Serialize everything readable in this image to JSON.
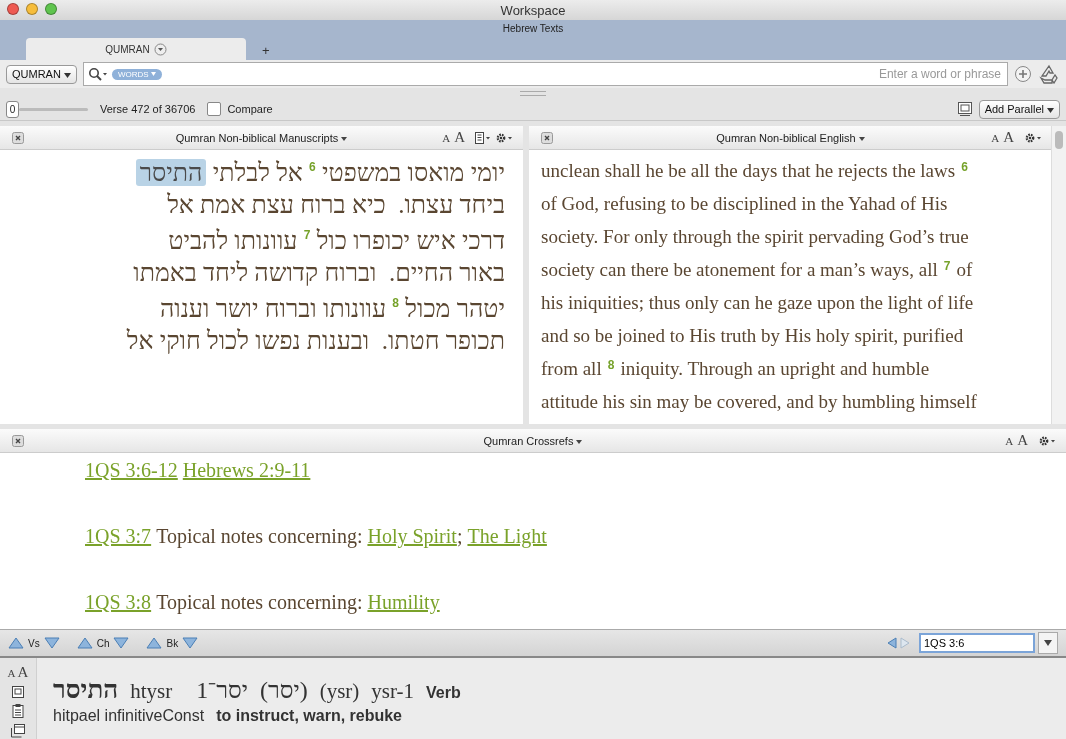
{
  "window": {
    "title": "Workspace",
    "subtitle": "Hebrew Texts"
  },
  "tabs": [
    {
      "label": "QUMRAN",
      "selected": true
    }
  ],
  "new_tab": "+",
  "search": {
    "module": "QUMRAN",
    "scope": "WORDS",
    "placeholder": "Enter a word or phrase"
  },
  "toolbar": {
    "slider_value": "0",
    "level": 0,
    "verse_info": "Verse 472 of 36706",
    "compare": {
      "label": "Compare",
      "checked": false
    },
    "add_parallel": "Add Parallel"
  },
  "panes": [
    {
      "title": "Qumran Non-biblical Manuscripts",
      "font_small": "A",
      "font_large": "A",
      "lines": [
        [
          {
            "kind": "text",
            "text": "יומי מואסו במשפטי "
          },
          {
            "kind": "verse",
            "text": "6"
          },
          {
            "kind": "text",
            "text": " אל לבלתי "
          },
          {
            "kind": "highlight",
            "text": "התיסר"
          }
        ],
        [
          {
            "kind": "text",
            "text": "ביחד עצתו.  כיא ברוח עצת אמת אל"
          }
        ],
        [
          {
            "kind": "text",
            "text": "דרכי איש יכופרו כול "
          },
          {
            "kind": "verse",
            "text": "7"
          },
          {
            "kind": "text",
            "text": " עוונותו להביט"
          }
        ],
        [
          {
            "kind": "text",
            "text": "באור החיים.  וברוח קדושה ליחד באמתו"
          }
        ],
        [
          {
            "kind": "text",
            "text": "יטהר מכול "
          },
          {
            "kind": "verse",
            "text": "8"
          },
          {
            "kind": "text",
            "text": " עוונותו וברוח יושר וענוה"
          }
        ],
        [
          {
            "kind": "text",
            "text": "תכופר חטתו.  ובענות נפשו לכול חוקי אל"
          }
        ]
      ]
    },
    {
      "title": "Qumran Non-biblical English",
      "font_small": "A",
      "font_large": "A",
      "lines": [
        [
          {
            "kind": "text",
            "text": "unclean shall he be all the days that he rejects the laws"
          },
          {
            "kind": "verse",
            "text": "6"
          }
        ],
        [
          {
            "kind": "text",
            "text": "of God, refusing to be disciplined in the Yahad of His"
          }
        ],
        [
          {
            "kind": "text",
            "text": "society. For only through the spirit pervading God’s true"
          }
        ],
        [
          {
            "kind": "text",
            "text": "society can there be atonement for a man’s ways, all"
          },
          {
            "kind": "verse",
            "text": "7"
          },
          {
            "kind": "text",
            "text": "of"
          }
        ],
        [
          {
            "kind": "text",
            "text": "his iniquities; thus only can he gaze upon the light of life"
          }
        ],
        [
          {
            "kind": "text",
            "text": "and so be joined to His truth by His holy spirit, purified"
          }
        ],
        [
          {
            "kind": "text",
            "text": "from all"
          },
          {
            "kind": "verse",
            "text": "8"
          },
          {
            "kind": "text",
            "text": "iniquity. Through an upright and humble"
          }
        ],
        [
          {
            "kind": "text",
            "text": "attitude his sin may be covered, and by humbling himself"
          }
        ]
      ]
    }
  ],
  "crossrefs": {
    "title": "Qumran Crossrefs",
    "font_small": "A",
    "font_large": "A",
    "entries": [
      [
        {
          "kind": "link",
          "text": "1QS 3:6-12"
        },
        {
          "kind": "link",
          "text": "Hebrews 2:9-11"
        }
      ],
      [
        {
          "kind": "link",
          "text": "1QS 3:7"
        },
        {
          "kind": "text",
          "text": "Topical notes concerning:"
        },
        {
          "kind": "link",
          "text": "Holy Spirit"
        },
        {
          "kind": "text",
          "text": ";"
        },
        {
          "kind": "link",
          "text": "The Light"
        }
      ],
      [
        {
          "kind": "link",
          "text": "1QS 3:8"
        },
        {
          "kind": "text",
          "text": "Topical notes concerning:"
        },
        {
          "kind": "link",
          "text": "Humility"
        }
      ]
    ]
  },
  "nav": {
    "steps": [
      "Vs",
      "Ch",
      "Bk"
    ],
    "reference": "1QS 3:6"
  },
  "info": {
    "font_small": "A",
    "font_large": "A",
    "word": "התיסר",
    "translit": "htysr",
    "lemma": "1⁻יסר",
    "root": "(יסר)",
    "root_translit": "(ysr)",
    "lemma_id": "ysr-1",
    "pos": "Verb",
    "morph": "hitpael infinitiveConst",
    "gloss": "to instruct, warn, rebuke"
  }
}
